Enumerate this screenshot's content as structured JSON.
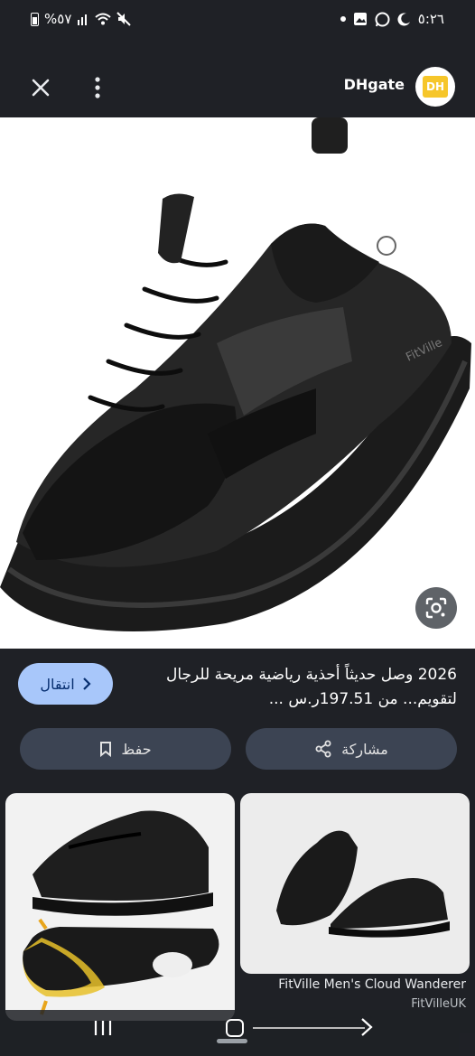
{
  "status_bar": {
    "battery_text": "%٥٧",
    "time": "٥:٢٦"
  },
  "header": {
    "site_name": "DHgate",
    "logo_text": "DH"
  },
  "product": {
    "title": "2026 وصل حديثاً أحذية رياضية مريحة للرجال لتقويم... من 197.51ر.س ...",
    "visit_label": "انتقال",
    "save_label": "حفظ",
    "share_label": "مشاركة",
    "shoe_brand_text": "FitVille"
  },
  "related": [
    {
      "caption": "",
      "source": ""
    },
    {
      "caption": "FitVille Men's Cloud Wanderer",
      "source": "FitVilleUK"
    }
  ],
  "colors": {
    "background": "#1f2126",
    "visit_button": "#a8c7fa",
    "pill_button": "#3c4453",
    "logo_yellow": "#f6c62a"
  }
}
